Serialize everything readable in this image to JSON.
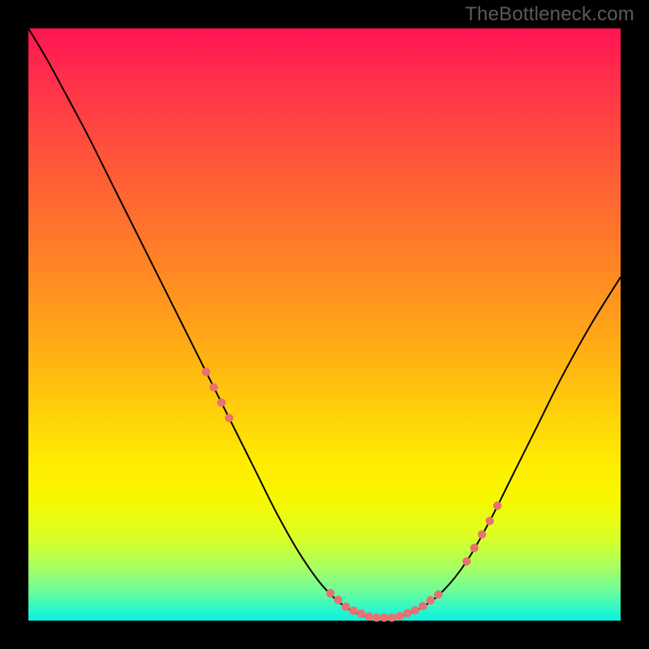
{
  "watermark": "TheBottleneck.com",
  "chart_data": {
    "type": "line",
    "title": "",
    "xlabel": "",
    "ylabel": "",
    "xlim": [
      0,
      100
    ],
    "ylim": [
      0,
      100
    ],
    "series": [
      {
        "name": "curve",
        "color": "#000000",
        "x": [
          0,
          3,
          6,
          10,
          14,
          18,
          22,
          26,
          30,
          34,
          38,
          42,
          46,
          50,
          54,
          58,
          62,
          66,
          70,
          74,
          78,
          82,
          86,
          90,
          95,
          100
        ],
        "y": [
          100,
          95,
          89.5,
          82,
          74,
          66,
          58,
          50,
          42,
          34,
          26,
          18,
          11,
          5.5,
          2,
          0.5,
          0.5,
          2,
          5,
          10,
          17,
          25,
          33,
          41,
          50,
          58
        ]
      }
    ],
    "highlighted_ranges": [
      {
        "x_start": 30,
        "x_end": 34,
        "color": "#e97171"
      },
      {
        "x_start": 51,
        "x_end": 70,
        "color": "#e97171"
      },
      {
        "x_start": 74,
        "x_end": 80,
        "color": "#e97171"
      }
    ],
    "background_gradient": {
      "direction": "vertical",
      "stops": [
        {
          "pos": 0,
          "color": "#ff1452"
        },
        {
          "pos": 0.5,
          "color": "#ffb014"
        },
        {
          "pos": 0.8,
          "color": "#f6f800"
        },
        {
          "pos": 1.0,
          "color": "#0af0e2"
        }
      ]
    }
  }
}
